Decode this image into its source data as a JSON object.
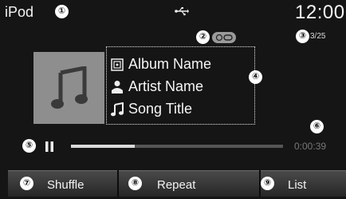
{
  "header": {
    "source": "iPod",
    "clock": "12:00",
    "track_count": "3/25",
    "usb_icon": "usb-icon",
    "repeat_indicator_icon": "repeat-indicator-icon"
  },
  "track_info": {
    "album": "Album Name",
    "artist": "Artist Name",
    "song": "Song Title"
  },
  "playback": {
    "state": "paused",
    "elapsed": "0:00:39",
    "progress": 0.3
  },
  "buttons": {
    "shuffle": "Shuffle",
    "repeat": "Repeat",
    "list": "List"
  },
  "callouts": [
    "①",
    "②",
    "③",
    "④",
    "⑤",
    "⑥",
    "⑦",
    "⑧",
    "⑨"
  ]
}
